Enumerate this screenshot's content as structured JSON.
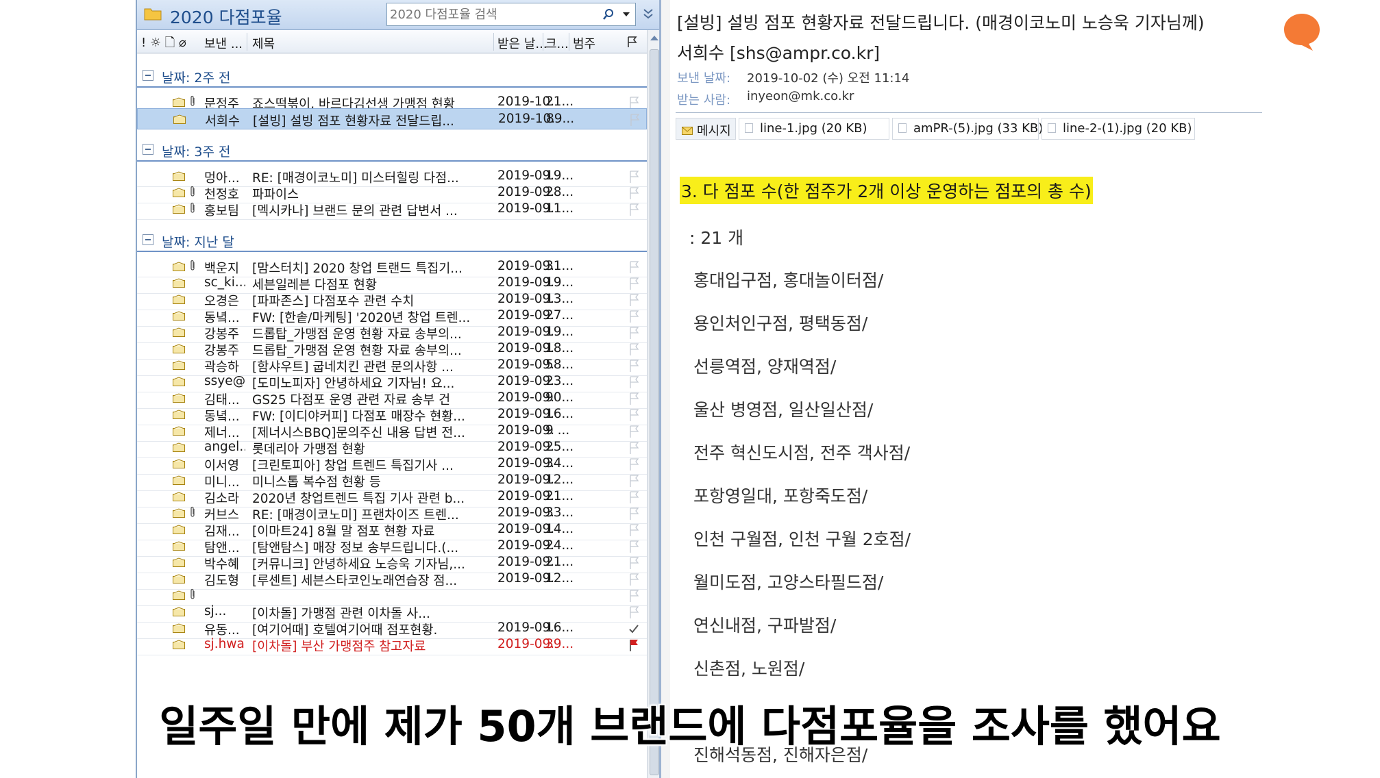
{
  "folder": {
    "title": "2020 다점포율",
    "search_placeholder": "2020 다점포율 검색"
  },
  "columns": {
    "icons": "! ☼ 🗋 ⌀",
    "from": "보낸 ...",
    "subject": "제목",
    "date": "받은 날...",
    "size": "크...",
    "category": "범주"
  },
  "groups": [
    {
      "label": "날짜: 2주 전",
      "rows": [
        {
          "from": "문정주",
          "subject": "죠스떡볶이, 바르다김선생 가맹점 현황",
          "date": "2019-10...",
          "size": "21...",
          "attach": true,
          "selected": false,
          "red": false
        },
        {
          "from": "서희수",
          "subject": "[설빙] 설빙 점포 현황자료 전달드립...",
          "date": "2019-10...",
          "size": "89...",
          "attach": false,
          "selected": true,
          "red": false
        }
      ]
    },
    {
      "label": "날짜: 3주 전",
      "rows": [
        {
          "from": "멍아...",
          "subject": "RE: [매경이코노미] 미스터힐링 다점...",
          "date": "2019-09...",
          "size": "19...",
          "attach": false,
          "selected": false,
          "red": false
        },
        {
          "from": "천정호",
          "subject": "파파이스",
          "date": "2019-09...",
          "size": "28...",
          "attach": true,
          "selected": false,
          "red": false
        },
        {
          "from": "홍보팀",
          "subject": "[멕시카나] 브랜드 문의 관련 답변서 ...",
          "date": "2019-09...",
          "size": "11...",
          "attach": true,
          "selected": false,
          "red": false
        }
      ]
    },
    {
      "label": "날짜: 지난 달",
      "rows": [
        {
          "from": "백운지",
          "subject": "[맘스터치] 2020 창업 트랜드 특집기...",
          "date": "2019-09...",
          "size": "31...",
          "attach": true,
          "selected": false,
          "red": false
        },
        {
          "from": "sc_ki...",
          "subject": "세븐일레븐 다점포 현황",
          "date": "2019-09...",
          "size": "19...",
          "attach": false,
          "selected": false,
          "red": false
        },
        {
          "from": "오경은",
          "subject": "[파파존스] 다점포수 관련 수치",
          "date": "2019-09...",
          "size": "13...",
          "attach": false,
          "selected": false,
          "red": false
        },
        {
          "from": "동녘...",
          "subject": "FW: [한솥/마케팅] '2020년 창업 트렌...",
          "date": "2019-09...",
          "size": "27...",
          "attach": false,
          "selected": false,
          "red": false
        },
        {
          "from": "강봉주",
          "subject": "드롭탑_가맹점 운영 현황 자료 송부의...",
          "date": "2019-09...",
          "size": "19...",
          "attach": false,
          "selected": false,
          "red": false
        },
        {
          "from": "강봉주",
          "subject": "드롭탑_가맹점 운영 현황 자료 송부의...",
          "date": "2019-09...",
          "size": "18...",
          "attach": false,
          "selected": false,
          "red": false
        },
        {
          "from": "곽승하",
          "subject": "[함샤우트] 굽네치킨 관련 문의사항 ...",
          "date": "2019-09...",
          "size": "58...",
          "attach": false,
          "selected": false,
          "red": false
        },
        {
          "from": "ssye@...",
          "subject": "[도미노피자] 안녕하세요 기자님! 요...",
          "date": "2019-09...",
          "size": "23...",
          "attach": false,
          "selected": false,
          "red": false
        },
        {
          "from": "김태...",
          "subject": "GS25 다점포 운영 관련 자료 송부 건",
          "date": "2019-09...",
          "size": "90...",
          "attach": false,
          "selected": false,
          "red": false
        },
        {
          "from": "동녘...",
          "subject": "FW: [이디야커피] 다점포 매장수 현황...",
          "date": "2019-09...",
          "size": "16...",
          "attach": false,
          "selected": false,
          "red": false
        },
        {
          "from": "제너...",
          "subject": "[제너시스BBQ]문의주신 내용 답변 전...",
          "date": "2019-09...",
          "size": "9 ...",
          "attach": false,
          "selected": false,
          "red": false
        },
        {
          "from": "angel...",
          "subject": "롯데리아 가맹점 현황",
          "date": "2019-09...",
          "size": "25...",
          "attach": false,
          "selected": false,
          "red": false
        },
        {
          "from": "이서영",
          "subject": "[크린토피아] 창업 트렌드 특집기사 ...",
          "date": "2019-09...",
          "size": "34...",
          "attach": false,
          "selected": false,
          "red": false
        },
        {
          "from": "미니...",
          "subject": "미니스톱 복수점 현황 등",
          "date": "2019-09...",
          "size": "12...",
          "attach": false,
          "selected": false,
          "red": false
        },
        {
          "from": "김소라",
          "subject": "2020년 창업트렌드 특집 기사 관련 b...",
          "date": "2019-09...",
          "size": "21...",
          "attach": false,
          "selected": false,
          "red": false
        },
        {
          "from": "커브스",
          "subject": "RE: [매경이코노미] 프랜차이즈 트렌...",
          "date": "2019-09...",
          "size": "33...",
          "attach": true,
          "selected": false,
          "red": false
        },
        {
          "from": "김재...",
          "subject": "[이마트24] 8월 말 점포 현황 자료",
          "date": "2019-09...",
          "size": "14...",
          "attach": false,
          "selected": false,
          "red": false
        },
        {
          "from": "탐앤...",
          "subject": "[탐앤탐스] 매장 정보 송부드립니다.(...",
          "date": "2019-09...",
          "size": "24...",
          "attach": false,
          "selected": false,
          "red": false
        },
        {
          "from": "박수혜",
          "subject": "[커뮤니크] 안녕하세요 노승욱 기자님,...",
          "date": "2019-09...",
          "size": "21...",
          "attach": false,
          "selected": false,
          "red": false
        },
        {
          "from": "김도형",
          "subject": "[루센트] 세븐스타코인노래연습장 점...",
          "date": "2019-09...",
          "size": "12...",
          "attach": false,
          "selected": false,
          "red": false
        },
        {
          "from": "",
          "subject": "",
          "date": "",
          "size": "",
          "attach": true,
          "selected": false,
          "red": false
        },
        {
          "from": "sj...",
          "subject": "[이차돌] 가맹점 관련 이차돌 사...",
          "date": "",
          "size": "",
          "attach": false,
          "selected": false,
          "red": false
        },
        {
          "from": "유동...",
          "subject": "[여기어때] 호텔여기어때 점포현황.",
          "date": "2019-09...",
          "size": "16...",
          "attach": false,
          "selected": false,
          "red": false,
          "check": true
        },
        {
          "from": "sj.hwa...",
          "subject": "[이차돌] 부산 가맹점주 참고자료",
          "date": "2019-09...",
          "size": "39...",
          "attach": false,
          "selected": false,
          "red": true,
          "flag": true
        }
      ]
    }
  ],
  "message": {
    "subject": "[설빙] 설빙 점포 현황자료 전달드립니다. (매경이코노미 노승욱 기자님께)",
    "sender": "서희수 [shs@ampr.co.kr]",
    "sent_label": "보낸 날짜:",
    "sent_value": "2019-10-02 (수) 오전 11:14",
    "to_label": "받는 사람:",
    "to_value": "inyeon@mk.co.kr",
    "tabs": [
      "메시지",
      "line-1.jpg (20 KB)",
      "amPR-(5).jpg (33 KB)",
      "line-2-(1).jpg (20 KB)"
    ],
    "heading": "3. 다 점포 수(한 점주가 2개 이상 운영하는 점포의 총 수)",
    "count": ": 21 개",
    "lines": [
      "홍대입구점, 홍대놀이터점/",
      "용인처인구점, 평택동점/",
      "선릉역점, 양재역점/",
      "울산 병영점, 일산일산점/",
      "전주 혁신도시점, 전주 객사점/",
      "포항영일대, 포항죽도점/",
      "인천 구월점, 인천 구월 2호점/",
      "월미도점, 고양스타필드점/",
      "연신내점, 구파발점/",
      "신촌점, 노원점/",
      "",
      "진해석동점, 진해자은점/"
    ]
  },
  "caption": "일주일 만에 제가 50개 브랜드에 다점포율을 조사를 했어요",
  "colors": {
    "accent": "#1f4e8c",
    "selected": "#bcd5f0",
    "highlight": "#f8ee1a",
    "bubble": "#f47a35"
  }
}
